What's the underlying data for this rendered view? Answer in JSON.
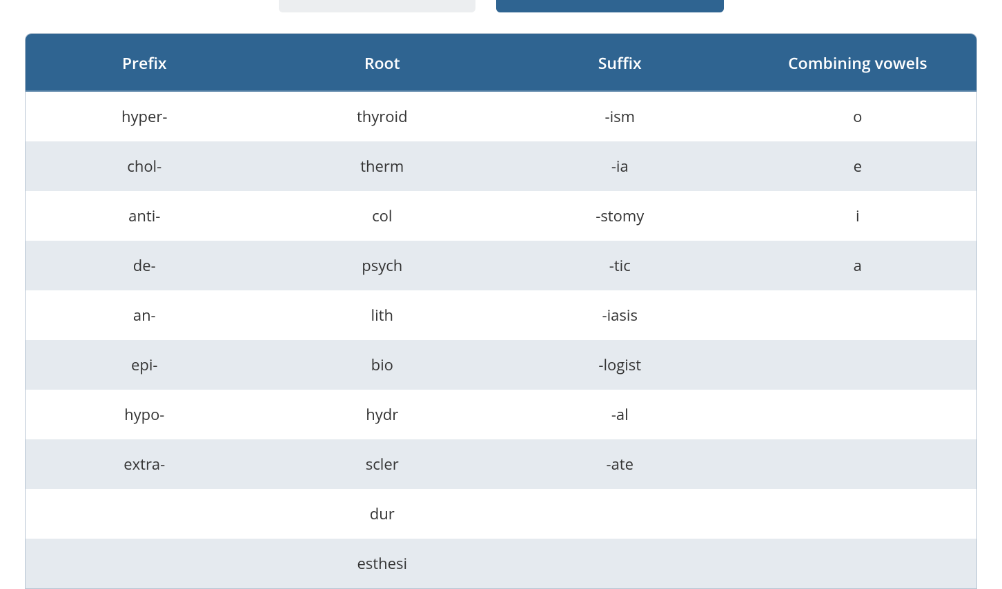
{
  "table": {
    "headers": [
      "Prefix",
      "Root",
      "Suffix",
      "Combining vowels"
    ],
    "rows": [
      {
        "prefix": "hyper-",
        "root": "thyroid",
        "suffix": "-ism",
        "vowel": "o"
      },
      {
        "prefix": "chol-",
        "root": "therm",
        "suffix": "-ia",
        "vowel": "e"
      },
      {
        "prefix": "anti-",
        "root": "col",
        "suffix": "-stomy",
        "vowel": "i"
      },
      {
        "prefix": "de-",
        "root": "psych",
        "suffix": "-tic",
        "vowel": "a"
      },
      {
        "prefix": "an-",
        "root": "lith",
        "suffix": "-iasis",
        "vowel": ""
      },
      {
        "prefix": "epi-",
        "root": "bio",
        "suffix": "-logist",
        "vowel": ""
      },
      {
        "prefix": "hypo-",
        "root": "hydr",
        "suffix": "-al",
        "vowel": ""
      },
      {
        "prefix": "extra-",
        "root": "scler",
        "suffix": "-ate",
        "vowel": ""
      },
      {
        "prefix": "",
        "root": "dur",
        "suffix": "",
        "vowel": ""
      },
      {
        "prefix": "",
        "root": "esthesi",
        "suffix": "",
        "vowel": ""
      }
    ]
  }
}
